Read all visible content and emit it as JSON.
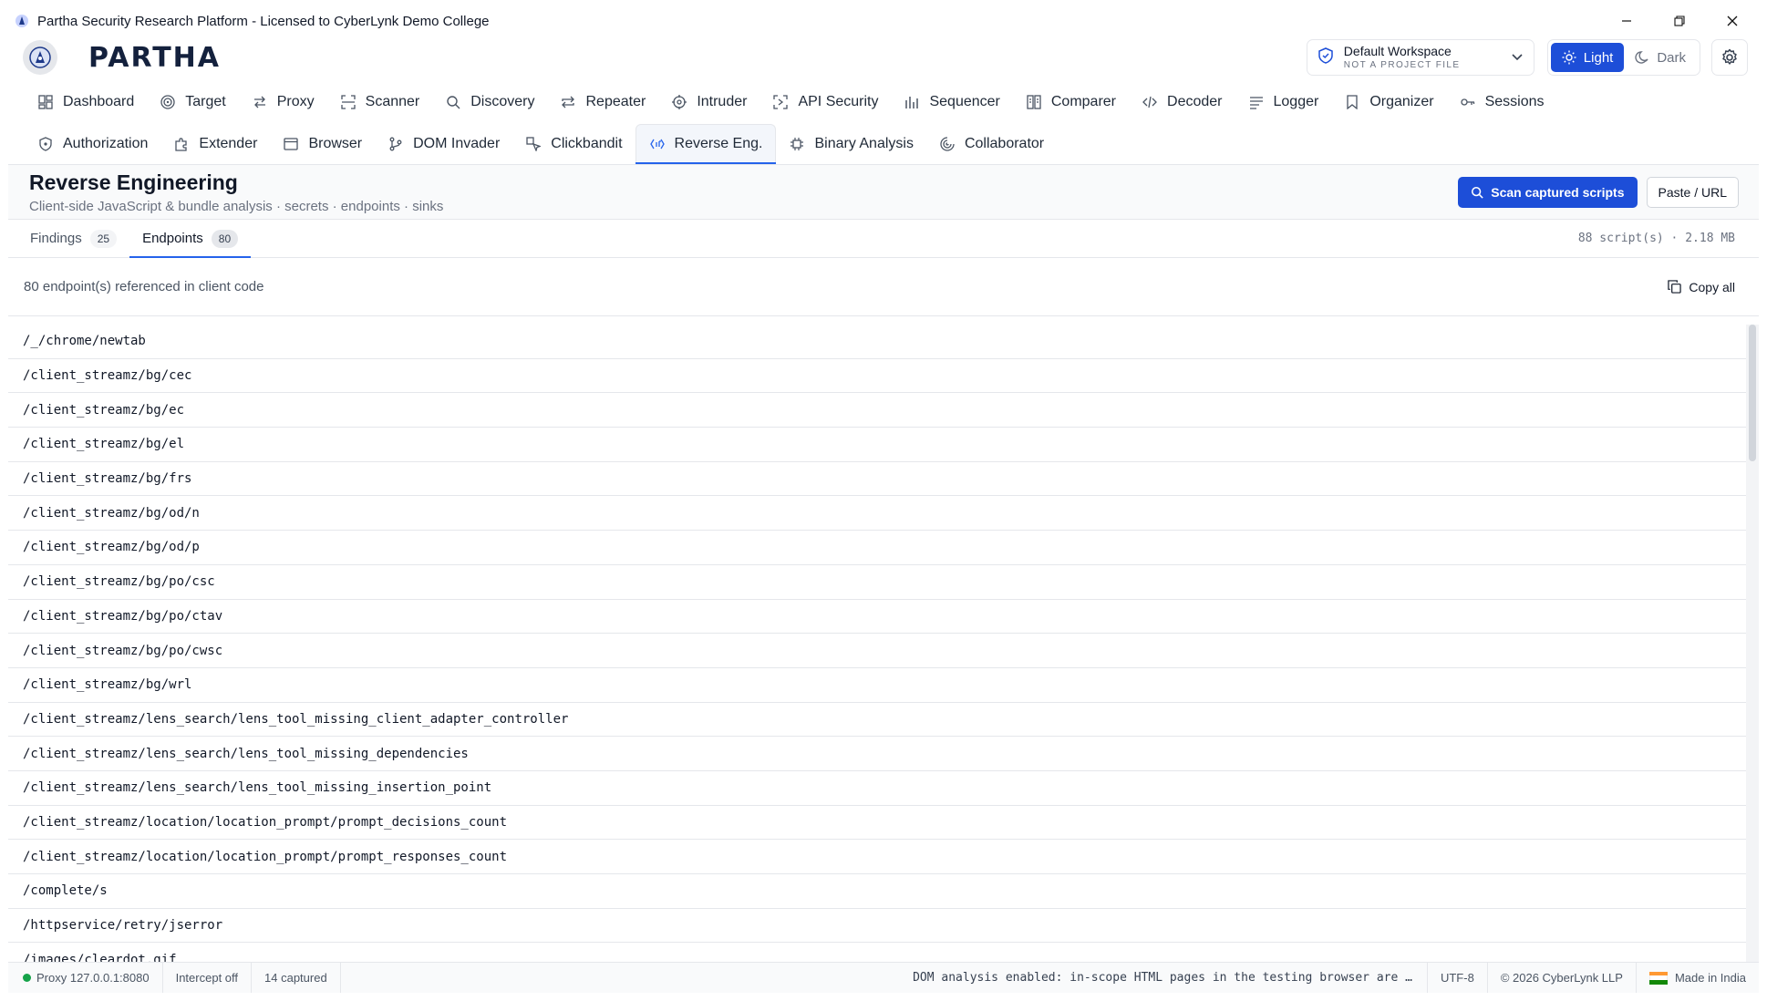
{
  "window": {
    "title": "Partha Security Research Platform - Licensed to CyberLynk Demo College"
  },
  "header": {
    "wordmark": "PARTHA",
    "workspace": {
      "name": "Default Workspace",
      "subtitle": "NOT A PROJECT FILE"
    },
    "theme": {
      "light_label": "Light",
      "dark_label": "Dark",
      "active": "light"
    }
  },
  "nav": {
    "row1": [
      {
        "label": "Dashboard",
        "icon": "grid-icon"
      },
      {
        "label": "Target",
        "icon": "target-icon"
      },
      {
        "label": "Proxy",
        "icon": "arrows-icon"
      },
      {
        "label": "Scanner",
        "icon": "scan-icon"
      },
      {
        "label": "Discovery",
        "icon": "search-icon"
      },
      {
        "label": "Repeater",
        "icon": "repeat-icon"
      },
      {
        "label": "Intruder",
        "icon": "crosshair-icon"
      },
      {
        "label": "API Security",
        "icon": "api-icon"
      },
      {
        "label": "Sequencer",
        "icon": "bar-chart-icon"
      },
      {
        "label": "Comparer",
        "icon": "columns-icon"
      },
      {
        "label": "Decoder",
        "icon": "code-icon"
      },
      {
        "label": "Logger",
        "icon": "list-icon"
      },
      {
        "label": "Organizer",
        "icon": "bookmark-icon"
      },
      {
        "label": "Sessions",
        "icon": "key-icon"
      }
    ],
    "row2": [
      {
        "label": "Authorization",
        "icon": "shield-icon"
      },
      {
        "label": "Extender",
        "icon": "puzzle-icon"
      },
      {
        "label": "Browser",
        "icon": "browser-icon"
      },
      {
        "label": "DOM Invader",
        "icon": "branch-icon"
      },
      {
        "label": "Clickbandit",
        "icon": "pointer-icon"
      },
      {
        "label": "Reverse Eng.",
        "icon": "file-code-icon",
        "active": true
      },
      {
        "label": "Binary Analysis",
        "icon": "cpu-icon"
      },
      {
        "label": "Collaborator",
        "icon": "radar-icon"
      }
    ]
  },
  "page": {
    "title": "Reverse Engineering",
    "subtitle": "Client-side JavaScript & bundle analysis · secrets · endpoints · sinks",
    "scan_button": "Scan captured scripts",
    "paste_button": "Paste / URL"
  },
  "tabs": {
    "findings": {
      "label": "Findings",
      "count": "25"
    },
    "endpoints": {
      "label": "Endpoints",
      "count": "80"
    },
    "stats": "88 script(s) · 2.18 MB"
  },
  "endpoints": {
    "summary": "80 endpoint(s) referenced in client code",
    "copy_label": "Copy all",
    "items": [
      "/_/chrome/newtab",
      "/client_streamz/bg/cec",
      "/client_streamz/bg/ec",
      "/client_streamz/bg/el",
      "/client_streamz/bg/frs",
      "/client_streamz/bg/od/n",
      "/client_streamz/bg/od/p",
      "/client_streamz/bg/po/csc",
      "/client_streamz/bg/po/ctav",
      "/client_streamz/bg/po/cwsc",
      "/client_streamz/bg/wrl",
      "/client_streamz/lens_search/lens_tool_missing_client_adapter_controller",
      "/client_streamz/lens_search/lens_tool_missing_dependencies",
      "/client_streamz/lens_search/lens_tool_missing_insertion_point",
      "/client_streamz/location/location_prompt/prompt_decisions_count",
      "/client_streamz/location/location_prompt/prompt_responses_count",
      "/complete/s",
      "/httpservice/retry/jserror",
      "/images/cleardot.gif"
    ]
  },
  "status": {
    "proxy": "Proxy 127.0.0.1:8080",
    "intercept": "Intercept off",
    "captured": "14 captured",
    "dom_message": "DOM analysis enabled: in-scope HTML pages in the testing browser are …",
    "encoding": "UTF-8",
    "copyright": "© 2026 CyberLynk LLP",
    "made_in": "Made in India"
  },
  "colors": {
    "accent": "#1d4ed8",
    "status_ok": "#16a34a",
    "brand_dark": "#14213d"
  }
}
